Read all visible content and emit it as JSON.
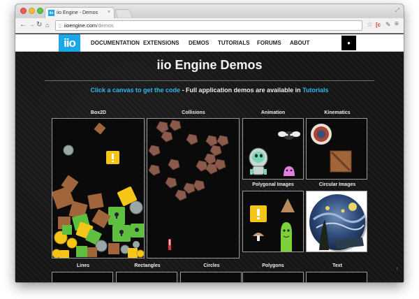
{
  "browser": {
    "tab_title": "iio Engine - Demos",
    "favicon_text": "iio",
    "tab_close": "×",
    "url_host": "iioengine.com",
    "url_path": "/demos"
  },
  "nav": {
    "logo": "iio",
    "links": [
      "DOCUMENTATION",
      "EXTENSIONS",
      "DEMOS",
      "TUTORIALS",
      "FORUMS",
      "ABOUT"
    ]
  },
  "page": {
    "title": "iio Engine Demos",
    "subtitle_lead": "Click a canvas to get the code",
    "subtitle_mid": " - Full application demos are available in ",
    "subtitle_link": "Tutorials"
  },
  "demos": {
    "box2d": "Box2D",
    "collisions": "Collisions",
    "animation": "Animation",
    "kinematics": "Kinematics",
    "polygonal_images": "Polygonal Images",
    "circular_images": "Circular Images",
    "lines": "Lines",
    "rectangles": "Rectangles",
    "circles": "Circles",
    "polygons": "Polygons",
    "text": "Text"
  },
  "colors": {
    "brand_blue": "#1aa8e8",
    "link_blue": "#2fb6f0",
    "crate_brown": "#a0653a",
    "item_yellow": "#f5c518",
    "pipe_green": "#5fbf3f"
  }
}
